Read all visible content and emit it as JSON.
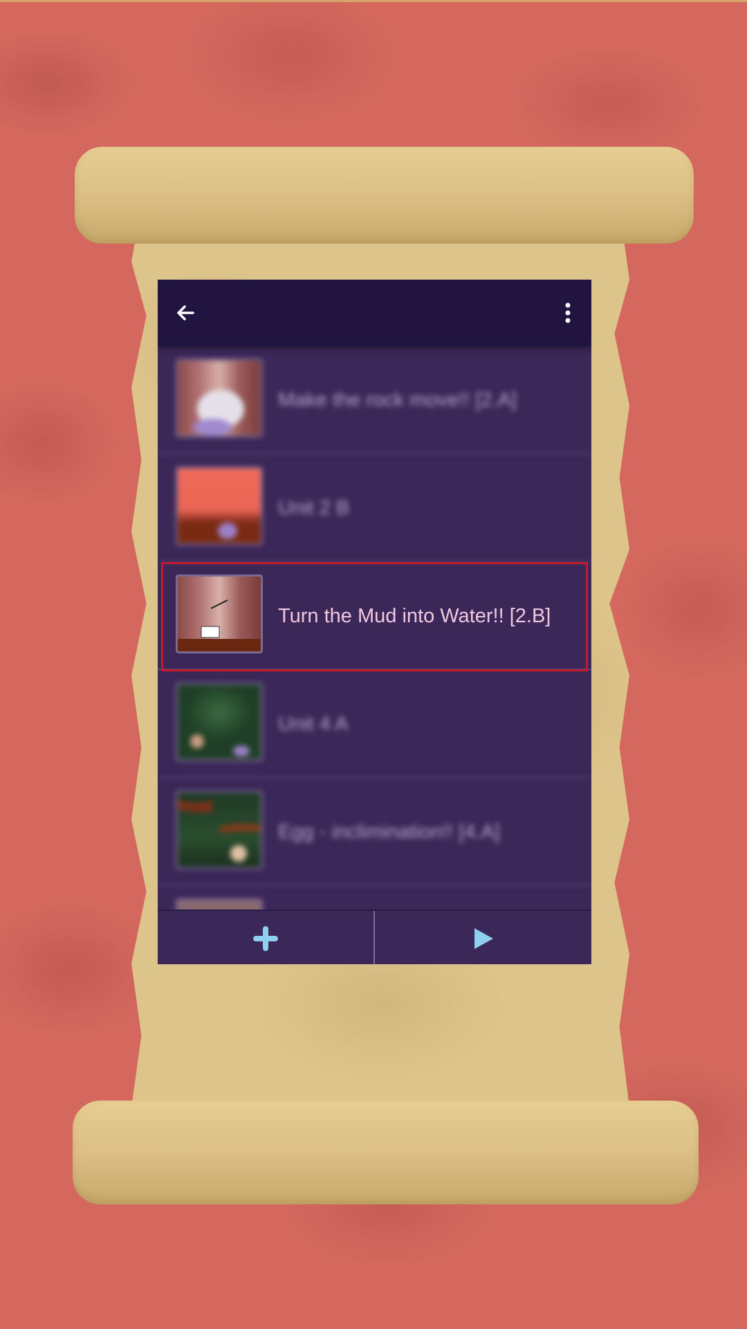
{
  "colors": {
    "background": "#d4685f",
    "appbar": "#211440",
    "list_background": "#3b2758",
    "highlight_border": "#c41a2c",
    "item_text": "#f0c8e0",
    "accent_icons": "#8fd0f0"
  },
  "appbar": {
    "back_icon": "arrow-left-icon",
    "menu_icon": "more-vert-icon"
  },
  "list": {
    "items": [
      {
        "label": "Make the rock move!! [2.A]",
        "thumbnail": "cave-scene",
        "selected": false
      },
      {
        "label": "Unit 2 B",
        "thumbnail": "sunset-scene",
        "selected": false
      },
      {
        "label": "Turn the Mud into Water!! [2.B]",
        "thumbnail": "cave-arrow-scene",
        "selected": true
      },
      {
        "label": "Unit 4 A",
        "thumbnail": "forest-scene",
        "selected": false
      },
      {
        "label": "Egg - inclimination!! [4.A]",
        "thumbnail": "forest-egg-scene",
        "selected": false
      }
    ]
  },
  "bottom_bar": {
    "add_icon": "plus-icon",
    "play_icon": "play-icon"
  }
}
